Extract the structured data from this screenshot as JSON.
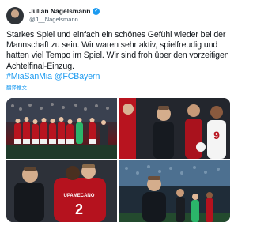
{
  "author": {
    "name": "Julian Nagelsmann",
    "handle": "@J__Nagelsmann"
  },
  "tweet": {
    "text": "Starkes Spiel und einfach ein schönes Gefühl wieder bei der Mannschaft zu sein. Wir waren sehr aktiv, spielfreudig und hatten viel Tempo im Spiel. Wir sind froh über den vorzeitigen Achtelfinal-Einzug.",
    "hashtags": "#MiaSanMia @FCBayern",
    "translate_label": "翻译推文"
  },
  "photos": {
    "p3_jersey_name": "UPAMECANO",
    "p3_jersey_number": "2",
    "p2_jersey_number": "9"
  },
  "colors": {
    "accent": "#1d9bf0",
    "text": "#0f1419",
    "muted": "#536471"
  }
}
